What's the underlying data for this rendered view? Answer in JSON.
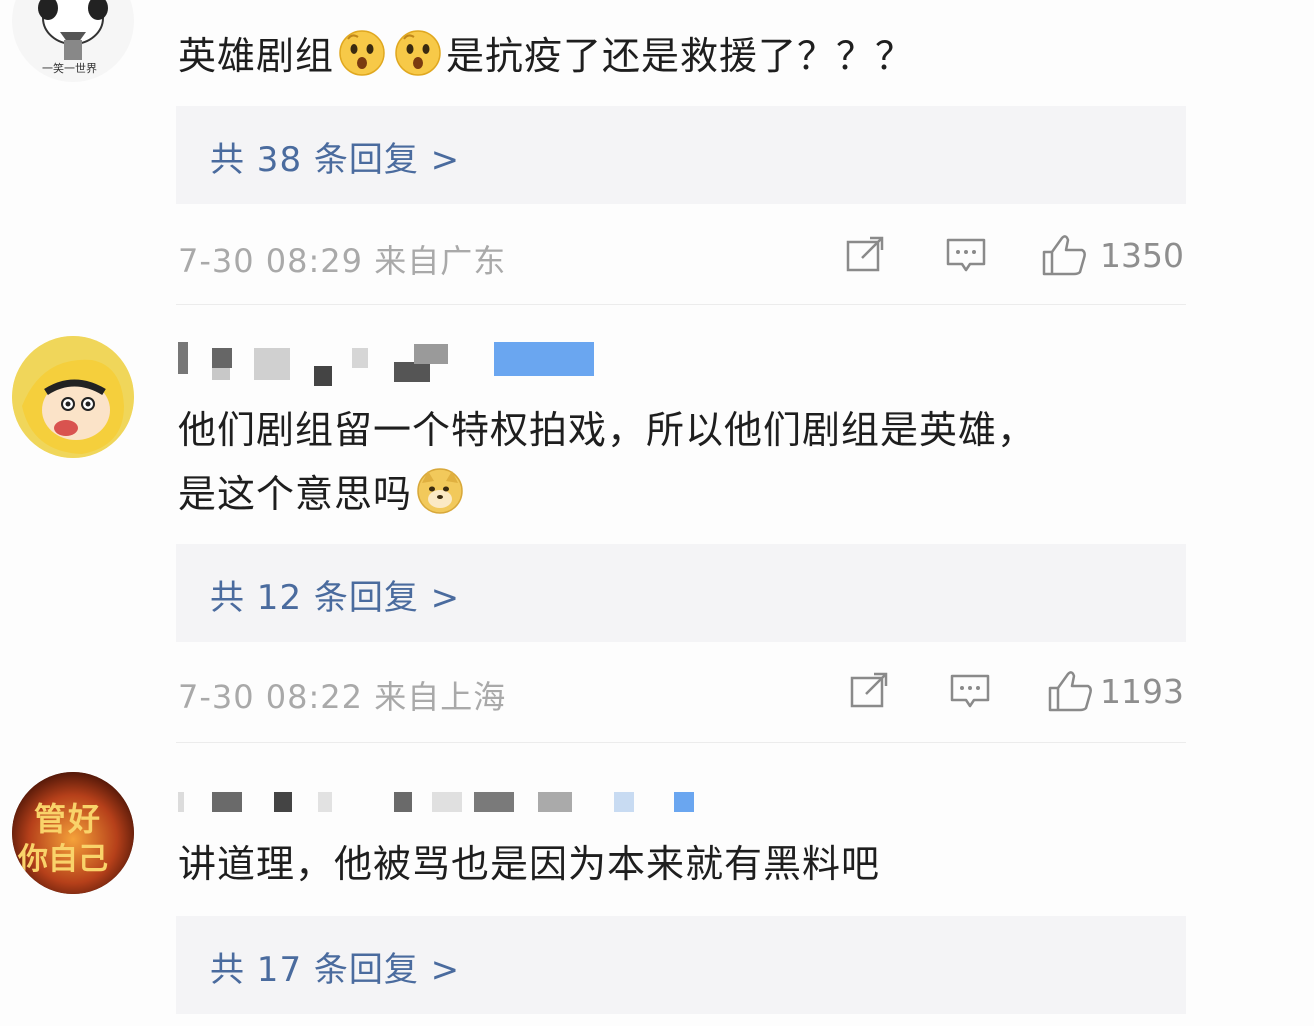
{
  "comments": [
    {
      "text_parts": [
        "英雄剧组",
        "是抗疫了还是救援了？？？"
      ],
      "replies": "共 38 条回复 >",
      "meta": "7-30 08:29  来自广东",
      "likes": "1350",
      "avatar_caption": "一笑一世界"
    },
    {
      "text_line1": "他们剧组留一个特权拍戏，所以他们剧组是英雄，",
      "text_line2": "是这个意思吗",
      "replies": "共 12 条回复 >",
      "meta": "7-30 08:22  来自上海",
      "likes": "1193"
    },
    {
      "text": "讲道理，他被骂也是因为本来就有黑料吧",
      "replies": "共 17 条回复 >",
      "avatar_caption_line1": "管好",
      "avatar_caption_line2": "你自己"
    }
  ],
  "icons": {
    "emoji_1": "surprised-face-icon",
    "emoji_2": "surprised-face-icon",
    "emoji_3": "doge-face-icon",
    "share": "share-icon",
    "reply": "comment-icon",
    "like": "thumbs-up-icon"
  },
  "colors": {
    "reply_link": "#4a6b9e",
    "meta_text": "#a9a9a9",
    "reply_box_bg": "#f4f4f6",
    "verified_badge": "#6aa6f0"
  }
}
